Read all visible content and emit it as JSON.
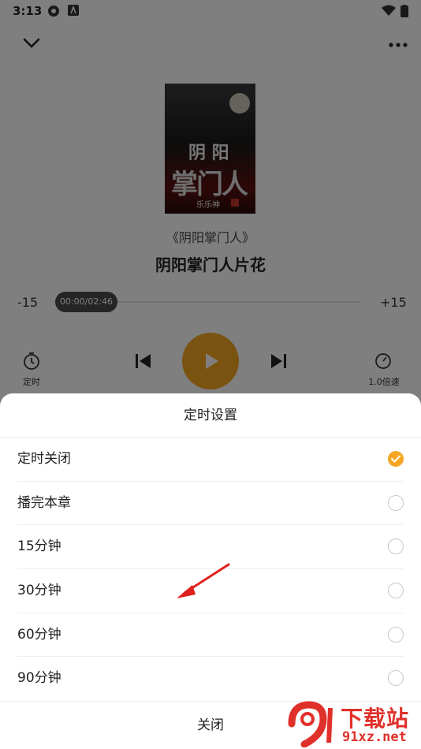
{
  "status_bar": {
    "time": "3:13"
  },
  "player": {
    "book_name": "《阴阳掌门人》",
    "chapter_title": "阴阳掌门人片花",
    "cover": {
      "title_line1": "阴 阳",
      "title_line2": "掌门人",
      "author": "乐乐神"
    },
    "rewind_label": "-15",
    "forward_label": "+15",
    "progress_time": "00:00/02:46",
    "progress_fraction": 0.0,
    "timer_label": "定时",
    "speed_label": "1.0倍速"
  },
  "timer_sheet": {
    "title": "定时设置",
    "options": [
      {
        "label": "定时关闭",
        "selected": true
      },
      {
        "label": "播完本章",
        "selected": false
      },
      {
        "label": "15分钟",
        "selected": false
      },
      {
        "label": "30分钟",
        "selected": false
      },
      {
        "label": "60分钟",
        "selected": false
      },
      {
        "label": "90分钟",
        "selected": false
      }
    ],
    "close_label": "关闭"
  },
  "watermark": {
    "top_text": "下载站",
    "bottom_text": "91xz.net"
  },
  "colors": {
    "accent": "#f5a623",
    "arrow": "#e0201c",
    "watermark": "#e0302a"
  }
}
